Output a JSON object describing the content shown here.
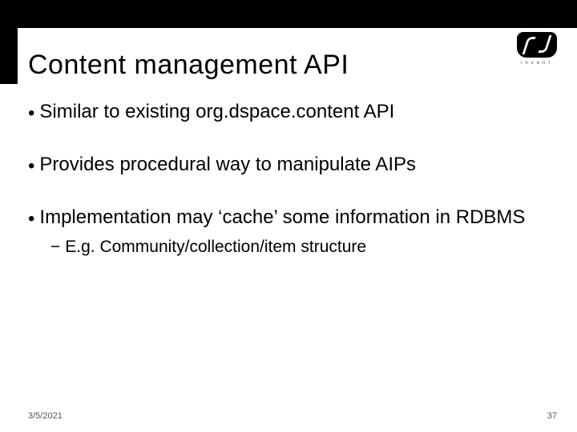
{
  "logo": {
    "text": "invent"
  },
  "title": "Content management API",
  "bullets": [
    {
      "text": "Similar to existing org.dspace.content API"
    },
    {
      "text": "Provides procedural way to manipulate AIPs"
    },
    {
      "text": "Implementation may ‘cache’ some information in RDBMS",
      "sub": [
        {
          "text": "E.g. Community/collection/item structure"
        }
      ]
    }
  ],
  "footer": {
    "date": "3/5/2021",
    "page": "37"
  }
}
